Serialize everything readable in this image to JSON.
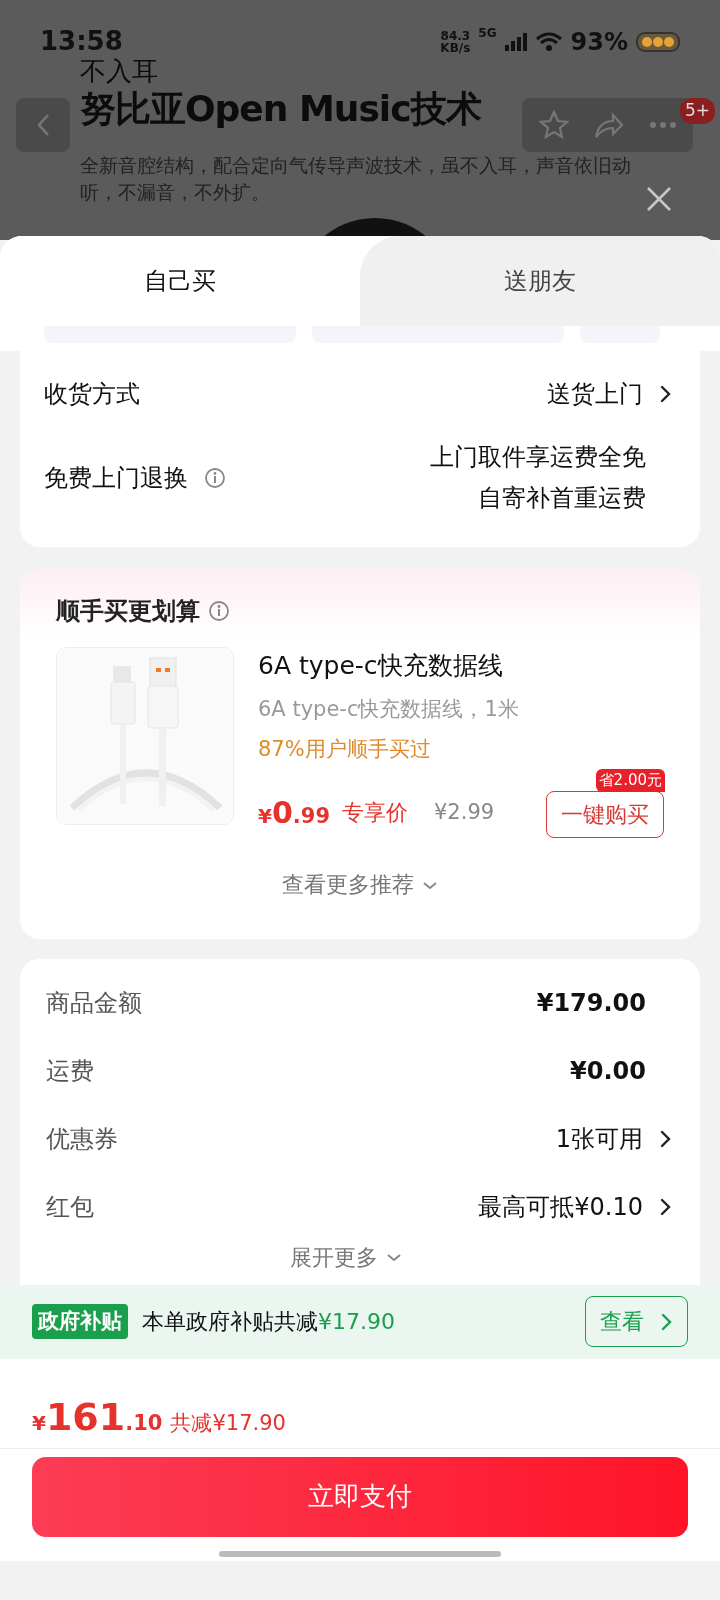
{
  "status_bar": {
    "time": "13:58",
    "net_speed": "84.3",
    "net_unit": "KB/s",
    "network": "5G",
    "battery": "93%"
  },
  "background_page": {
    "eyebrow": "不入耳",
    "title": "努比亚Open Music技术",
    "description": "全新音腔结构，配合定向气传导声波技术，虽不入耳，声音依旧动听，不漏音，不外扩。",
    "badge": "5+"
  },
  "tabs": [
    {
      "label": "自己买",
      "selected": true
    },
    {
      "label": "送朋友",
      "selected": false
    }
  ],
  "delivery": {
    "shipping": {
      "label": "收货方式",
      "value": "送货上门"
    },
    "returns": {
      "label": "免费上门退换",
      "lines": [
        "上门取件享运费全免",
        "自寄补首重运费"
      ]
    }
  },
  "addon": {
    "title": "顺手买更划算",
    "product": {
      "kind": "picture",
      "name": "6A type-c快充数据线",
      "subtitle": "6A type-c快充数据线，1米",
      "social_proof": "87%用户顺手买过",
      "currency": "¥",
      "price_int": "0",
      "price_dec": ".99",
      "price_tag": "专享价",
      "original_price": "¥2.99",
      "saving_badge": "省2.00元",
      "buy_button": "一键购买"
    },
    "more": "查看更多推荐"
  },
  "summary": {
    "rows": [
      {
        "label": "商品金额",
        "value": "¥179.00",
        "arrow": false,
        "bold": true
      },
      {
        "label": "运费",
        "value": "¥0.00",
        "arrow": false,
        "bold": true
      },
      {
        "label": "优惠券",
        "value": "1张可用",
        "arrow": true,
        "bold": false
      },
      {
        "label": "红包",
        "value": "最高可抵¥0.10",
        "arrow": true,
        "bold": false
      }
    ],
    "expand": "展开更多"
  },
  "subsidy": {
    "tag": "政府补贴",
    "text": "本单政府补贴共减",
    "amount": "¥17.90",
    "button": "查看"
  },
  "footer": {
    "currency": "¥",
    "total_int": "161",
    "total_dec": ".10",
    "discount": "共减¥17.90",
    "pay_button": "立即支付"
  }
}
